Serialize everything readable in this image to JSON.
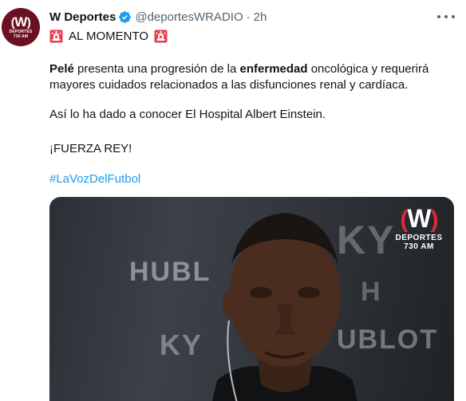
{
  "tweet": {
    "avatar": {
      "logo_letter": "W",
      "logo_sub_1": "DEPORTES",
      "logo_sub_2": "730 AM",
      "background_color": "#6b1022"
    },
    "display_name": "W Deportes",
    "verified_icon": "verified-badge-icon",
    "handle": "@deportesWRADIO",
    "separator": "·",
    "time": "2h",
    "more_icon": "more-options-icon",
    "alert": {
      "left_icon": "siren-emoji-icon",
      "text": "AL MOMENTO",
      "right_icon": "siren-emoji-icon"
    },
    "paragraph_1": {
      "bold_1": "Pelé",
      "text_1": " presenta una progresión de la ",
      "bold_2": "enfermedad",
      "text_2": " oncológica y requerirá mayores cuidados relacionados a las disfunciones renal y cardíaca."
    },
    "paragraph_2": "Así lo ha dado a conocer El Hospital Albert Einstein.",
    "paragraph_3": "¡FUERZA REY!",
    "hashtag": "#LaVozDelFutbol",
    "media": {
      "background_text_1": "HUBL",
      "background_text_2": "KY",
      "background_text_3": "KY",
      "background_text_4": "UBLOT",
      "background_text_5": "H",
      "logo_letter": "W",
      "logo_sub_1": "DEPORTES",
      "logo_sub_2": "730 AM"
    },
    "colors": {
      "link": "#1d9bf0",
      "secondary_text": "#536471",
      "primary_text": "#0f1419",
      "verified": "#1d9bf0"
    }
  }
}
